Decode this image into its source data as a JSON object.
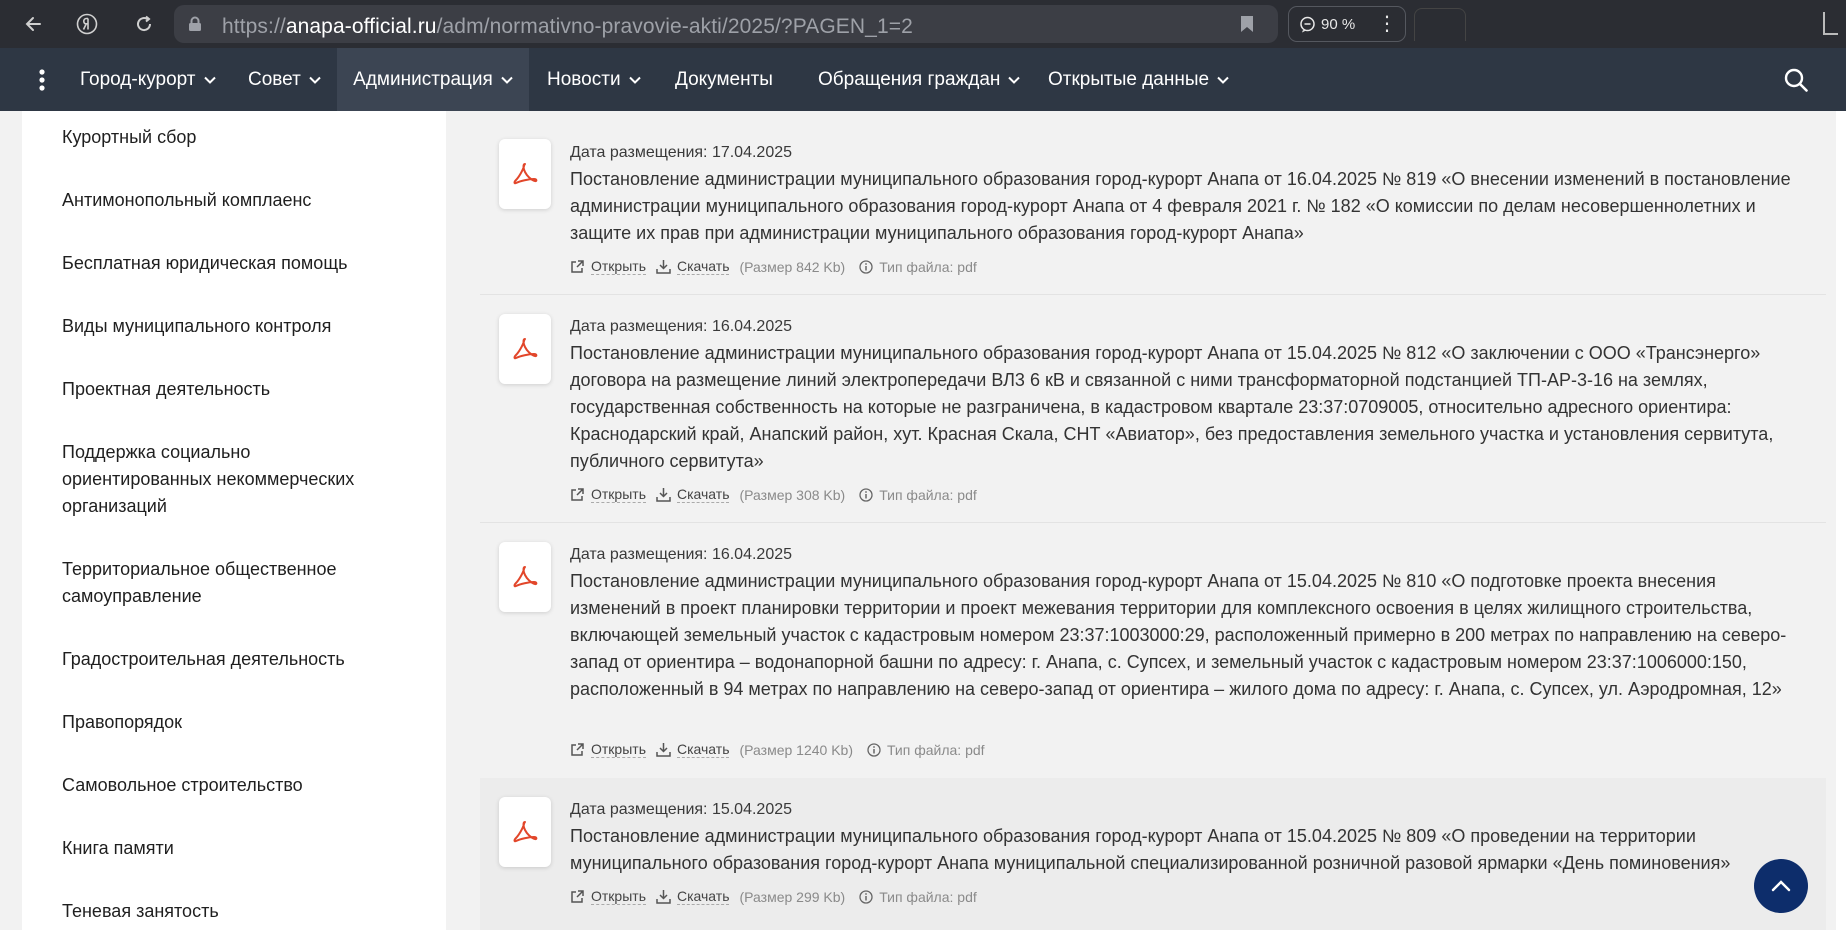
{
  "browser": {
    "url_scheme": "https://",
    "url_host": "anapa-official.ru",
    "url_path": "/adm/normativno-pravovie-akti/2025/?PAGEN_1=2",
    "zoom": "90 %"
  },
  "nav": {
    "items": [
      {
        "label": "Город-курорт"
      },
      {
        "label": "Совет"
      },
      {
        "label": "Администрация"
      },
      {
        "label": "Новости"
      },
      {
        "label": "Документы"
      },
      {
        "label": "Обращения граждан"
      },
      {
        "label": "Открытые данные"
      }
    ]
  },
  "sidebar": {
    "items": [
      {
        "label": "Курортный сбор"
      },
      {
        "label": "Антимонопольный комплаенс"
      },
      {
        "label": "Бесплатная юридическая помощь"
      },
      {
        "label": "Виды муниципального контроля"
      },
      {
        "label": "Проектная деятельность"
      },
      {
        "label": "Поддержка социально ориентированных некоммерческих организаций"
      },
      {
        "label": "Территориальное общественное самоуправление"
      },
      {
        "label": "Градостроительная деятельность"
      },
      {
        "label": "Правопорядок"
      },
      {
        "label": "Самовольное строительство"
      },
      {
        "label": "Книга памяти"
      },
      {
        "label": "Теневая занятость"
      }
    ]
  },
  "documents": [
    {
      "date": "Дата размещения: 17.04.2025",
      "title": "Постановление администрации муниципального образования город-курорт Анапа от 16.04.2025 № 819 «О внесении изменений в постановление администрации муниципального образования город-курорт Анапа от 4 февраля 2021 г. № 182 «О комиссии по делам несовершеннолетних и защите их прав при администрации муниципального образования город-курорт Анапа»",
      "open": "Открыть",
      "download": "Скачать",
      "size": "(Размер 842 Kb)",
      "type": "Тип файла: pdf"
    },
    {
      "date": "Дата размещения: 16.04.2025",
      "title": "Постановление администрации муниципального образования город-курорт Анапа от 15.04.2025 № 812 «О заключении с ООО «Трансэнерго» договора на размещение линий электропередачи ВЛ3 6 кВ и связанной с ними трансформаторной подстанцией ТП-АР-3-16 на землях, государственная собственность на которые не разграничена, в кадастровом квартале 23:37:0709005, относительно адресного ориентира: Краснодарский край, Анапский район, хут. Красная Скала, СНТ «Авиатор», без предоставления земельного участка и установления сервитута, публичного сервитута»",
      "open": "Открыть",
      "download": "Скачать",
      "size": "(Размер 308 Kb)",
      "type": "Тип файла: pdf"
    },
    {
      "date": "Дата размещения: 16.04.2025",
      "title": "Постановление администрации муниципального образования город-курорт Анапа от 15.04.2025 № 810 «О подготовке проекта внесения изменений в проект планировки территории и проект межевания территории для комплексного освоения в целях жилищного строительства, включающей земельный участок с кадастровым номером 23:37:1003000:29, расположенный примерно в 200 метрах по направлению на северо-запад от ориентира – водонапорной башни по адресу: г. Анапа, с. Супсех, и земельный участок с кадастровым номером 23:37:1006000:150, расположенный в 94 метрах по направлению на северо-запад от ориентира – жилого дома по адресу: г. Анапа, с. Супсех, ул. Аэродромная, 12»",
      "open": "Открыть",
      "download": "Скачать",
      "size": "(Размер 1240 Kb)",
      "type": "Тип файла: pdf"
    },
    {
      "date": "Дата размещения: 15.04.2025",
      "title": "Постановление администрации муниципального образования город-курорт Анапа от 15.04.2025 № 809 «О проведении на территории муниципального образования город-курорт Анапа муниципальной специализированной розничной разовой ярмарки «День поминовения»",
      "open": "Открыть",
      "download": "Скачать",
      "size": "(Размер 299 Kb)",
      "type": "Тип файла: pdf"
    }
  ]
}
